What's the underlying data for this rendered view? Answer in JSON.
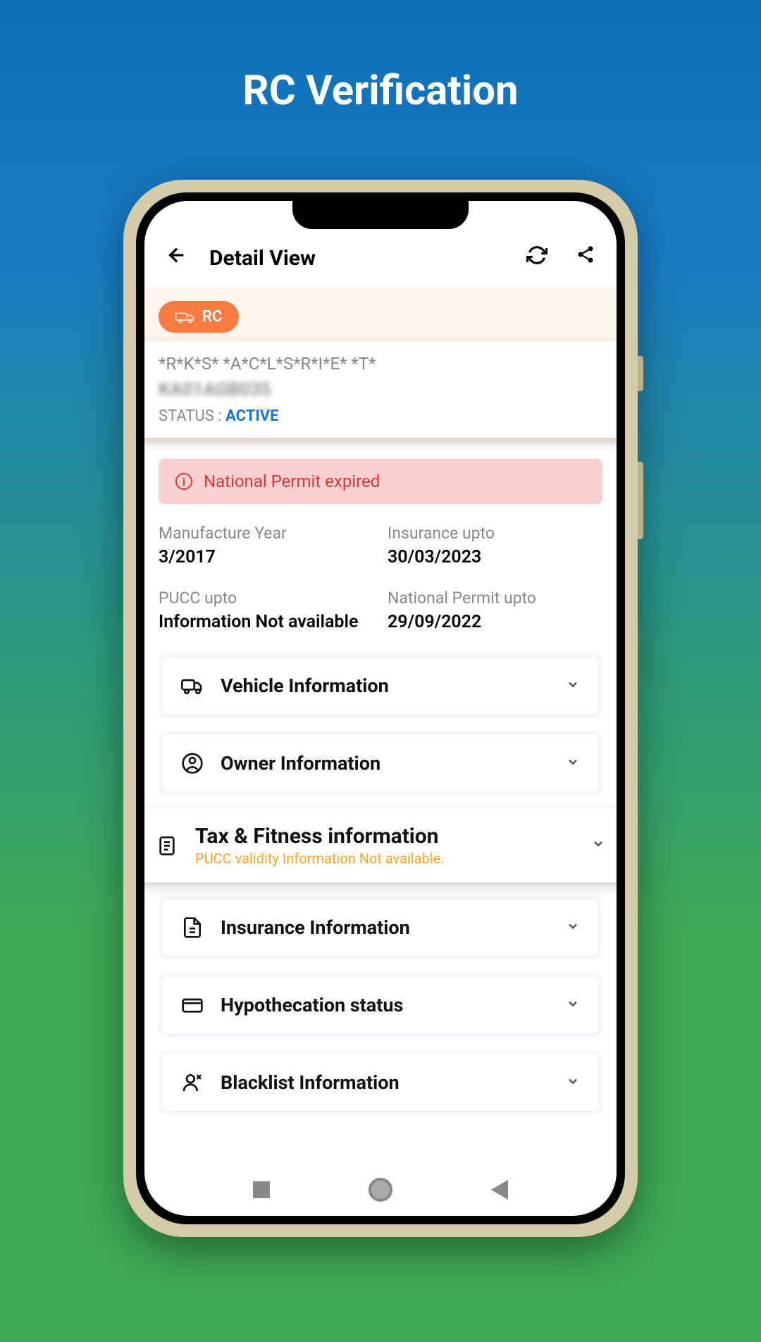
{
  "page": {
    "title": "RC Verification"
  },
  "header": {
    "title": "Detail View"
  },
  "rc": {
    "chip_label": "RC",
    "owner_name": "*R*K*S* *A*C*L*S*R*I*E* *T*",
    "reg_number": "KA01AGB035",
    "status_label": "STATUS : ",
    "status_value": "ACTIVE"
  },
  "alert": {
    "text": "National Permit expired"
  },
  "info": {
    "manufacture_year": {
      "label": "Manufacture Year",
      "value": "3/2017"
    },
    "insurance_upto": {
      "label": "Insurance upto",
      "value": "30/03/2023"
    },
    "pucc_upto": {
      "label": "PUCC upto",
      "value": "Information Not available"
    },
    "national_permit_upto": {
      "label": "National Permit upto",
      "value": "29/09/2022"
    }
  },
  "accordions": {
    "vehicle": {
      "title": "Vehicle Information"
    },
    "owner": {
      "title": "Owner Information"
    },
    "tax_fitness": {
      "title": "Tax & Fitness information",
      "subtitle": "PUCC validity Information Not available."
    },
    "insurance": {
      "title": "Insurance Information"
    },
    "hypothecation": {
      "title": "Hypothecation status"
    },
    "blacklist": {
      "title": "Blacklist Information"
    }
  }
}
